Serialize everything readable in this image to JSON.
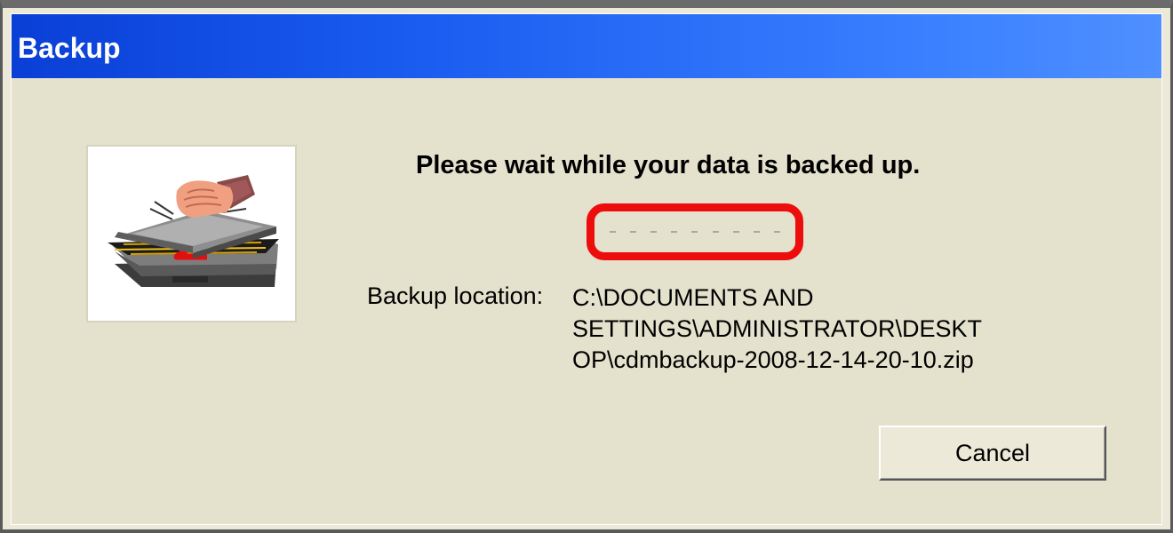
{
  "window": {
    "title": "Backup"
  },
  "dialog": {
    "message": "Please wait while your data is backed up.",
    "progress": {
      "segments": 9,
      "highlight_color": "#ee0d0d"
    },
    "backup_location": {
      "label": "Backup location:",
      "lines": [
        "C:\\DOCUMENTS AND",
        "SETTINGS\\ADMINISTRATOR\\DESKT",
        "OP\\cdmbackup-2008-12-14-20-10.zip"
      ]
    },
    "cancel_label": "Cancel",
    "icon": "backup-briefcase-icon"
  },
  "colors": {
    "titlebar_start": "#0a3fd6",
    "titlebar_end": "#4f8fff",
    "dialog_bg": "#e4e1cd"
  }
}
